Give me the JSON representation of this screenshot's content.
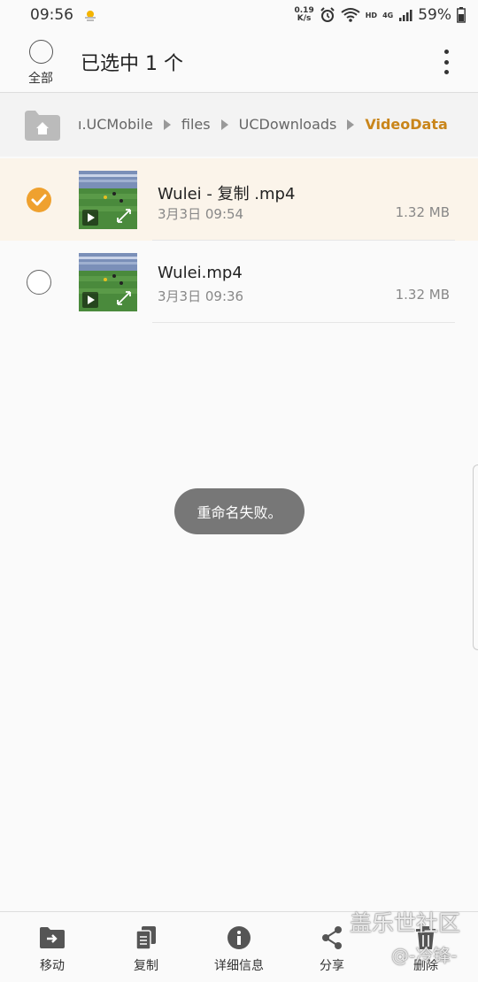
{
  "status_bar": {
    "time": "09:56",
    "speed_top": "0.19",
    "speed_unit": "K/s",
    "network_label": "HD",
    "signal_label": "4G",
    "battery": "59%"
  },
  "header": {
    "select_all_label": "全部",
    "title": "已选中 1 个"
  },
  "breadcrumb": {
    "items": [
      "ı.UCMobile",
      "files",
      "UCDownloads",
      "VideoData"
    ]
  },
  "files": [
    {
      "name": "Wulei - 复制 .mp4",
      "date": "3月3日 09:54",
      "size": "1.32 MB",
      "selected": true
    },
    {
      "name": "Wulei.mp4",
      "date": "3月3日 09:36",
      "size": "1.32 MB",
      "selected": false
    }
  ],
  "toast": "重命名失败。",
  "toolbar": {
    "move": "移动",
    "copy": "复制",
    "details": "详细信息",
    "share": "分享",
    "delete": "删除"
  },
  "watermark": {
    "line1": "盖乐世社区",
    "line2": "@-冷锋-"
  },
  "colors": {
    "accent": "#c9851a",
    "check": "#efa12f",
    "selected_row": "#fbf4ea"
  }
}
